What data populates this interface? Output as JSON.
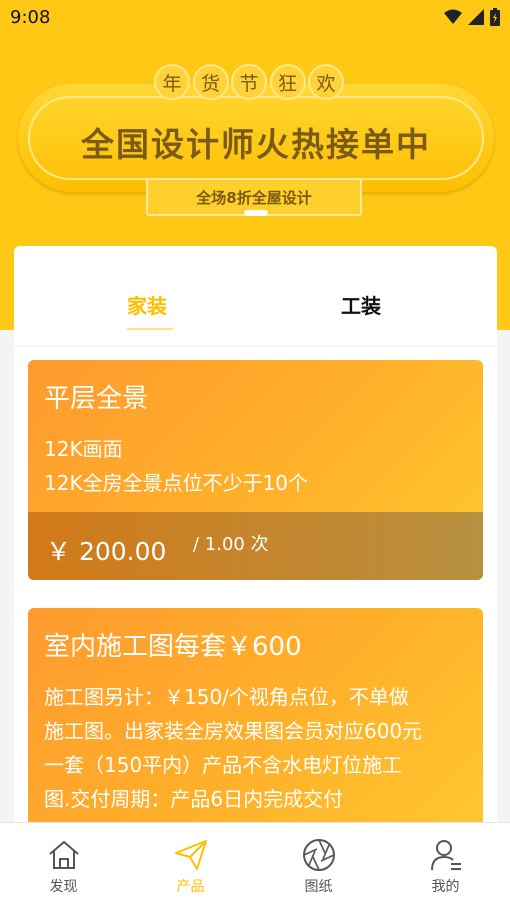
{
  "status_bar": {
    "time": "9:08"
  },
  "banner": {
    "festival_chars": [
      "年",
      "货",
      "节",
      "狂",
      "欢"
    ],
    "title": "全国设计师火热接单中",
    "subtitle": "全场8折全屋设计"
  },
  "tabs": [
    {
      "label": "家装",
      "active": true
    },
    {
      "label": "工装",
      "active": false
    }
  ],
  "cards": [
    {
      "title": "平层全景",
      "lines": [
        "12K画面",
        "12K全房全景点位不少于10个"
      ],
      "price": "￥ 200.00",
      "unit": "/ 1.00 次"
    },
    {
      "title": "室内施工图每套￥600",
      "lines": [
        "施工图另计：￥150/个视角点位，不单做",
        "施工图。出家装全房效果图会员对应600元",
        "一套（150平内）产品不含水电灯位施工",
        "图.交付周期：产品6日内完成交付"
      ]
    }
  ],
  "bottom_nav": [
    {
      "label": "发现",
      "icon": "home-icon"
    },
    {
      "label": "产品",
      "icon": "paper-plane-icon",
      "active": true
    },
    {
      "label": "图纸",
      "icon": "aperture-icon"
    },
    {
      "label": "我的",
      "icon": "user-icon"
    }
  ],
  "colors": {
    "brand_yellow": "#ffc814",
    "active_tab": "#ffbf00",
    "card_gradient_start": "#ff9a2e",
    "card_gradient_end": "#ffc830"
  }
}
